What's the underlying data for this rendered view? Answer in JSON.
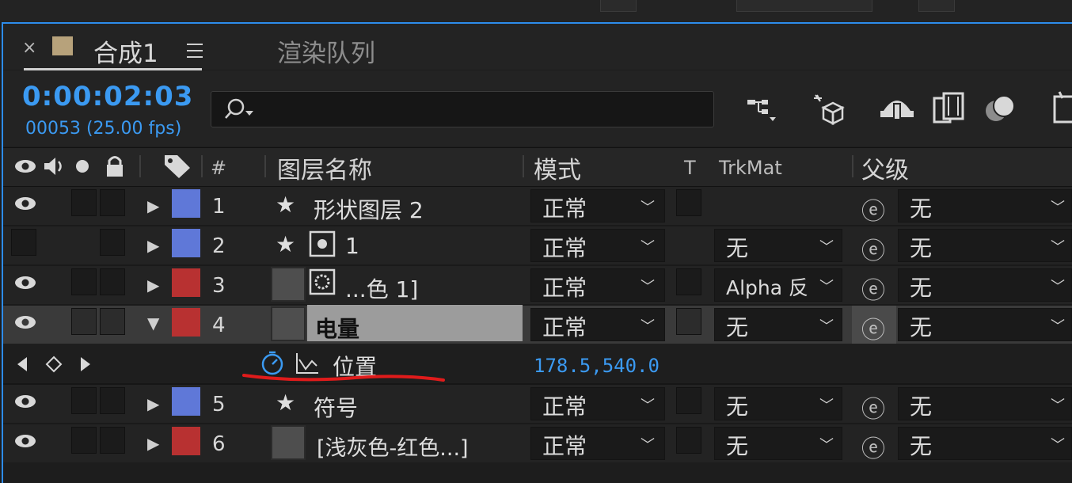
{
  "tabs": {
    "close": "×",
    "comp_name": "合成1",
    "comp_menu": "≡",
    "render_queue": "渲染队列",
    "swatch_color": "#b7a27b"
  },
  "header": {
    "timecode": "0:00:02:03",
    "frame_info": "00053 (25.00 fps)",
    "search_placeholder": ""
  },
  "toolbar_icons": [
    "flowchart-icon",
    "draft-3d-icon",
    "motion-blur-icon",
    "frame-blending-icon",
    "shy-layers-icon",
    "graph-editor-icon"
  ],
  "columns": {
    "num": "#",
    "name": "图层名称",
    "mode": "模式",
    "t": "T",
    "trkmat": "TrkMat",
    "parent": "父级"
  },
  "colors": {
    "blue_label": "#5f78d8",
    "red_label": "#b83131",
    "accent": "#3b9af2"
  },
  "layers": [
    {
      "num": "1",
      "name": "形状图层 2",
      "mode": "正常",
      "trkmat": "",
      "parent": "无",
      "expanded": false
    },
    {
      "num": "2",
      "name": "1",
      "mode": "正常",
      "trkmat": "无",
      "parent": "无",
      "expanded": false
    },
    {
      "num": "3",
      "name": "...色 1]",
      "mode": "正常",
      "trkmat": "Alpha 反",
      "parent": "无",
      "expanded": false
    },
    {
      "num": "4",
      "name": "电量",
      "mode": "正常",
      "trkmat": "无",
      "parent": "无",
      "expanded": true
    },
    {
      "num": "5",
      "name": "符号",
      "mode": "正常",
      "trkmat": "无",
      "parent": "无",
      "expanded": false
    },
    {
      "num": "6",
      "name": "[浅灰色-红色...]",
      "mode": "正常",
      "trkmat": "无",
      "parent": "无",
      "expanded": false
    }
  ],
  "property": {
    "name": "位置",
    "value": "178.5,540.0"
  },
  "glyphs": {
    "expand": "▶",
    "collapse": "▼",
    "star": "★",
    "chev": "﹀",
    "spiral": "ⓔ"
  }
}
